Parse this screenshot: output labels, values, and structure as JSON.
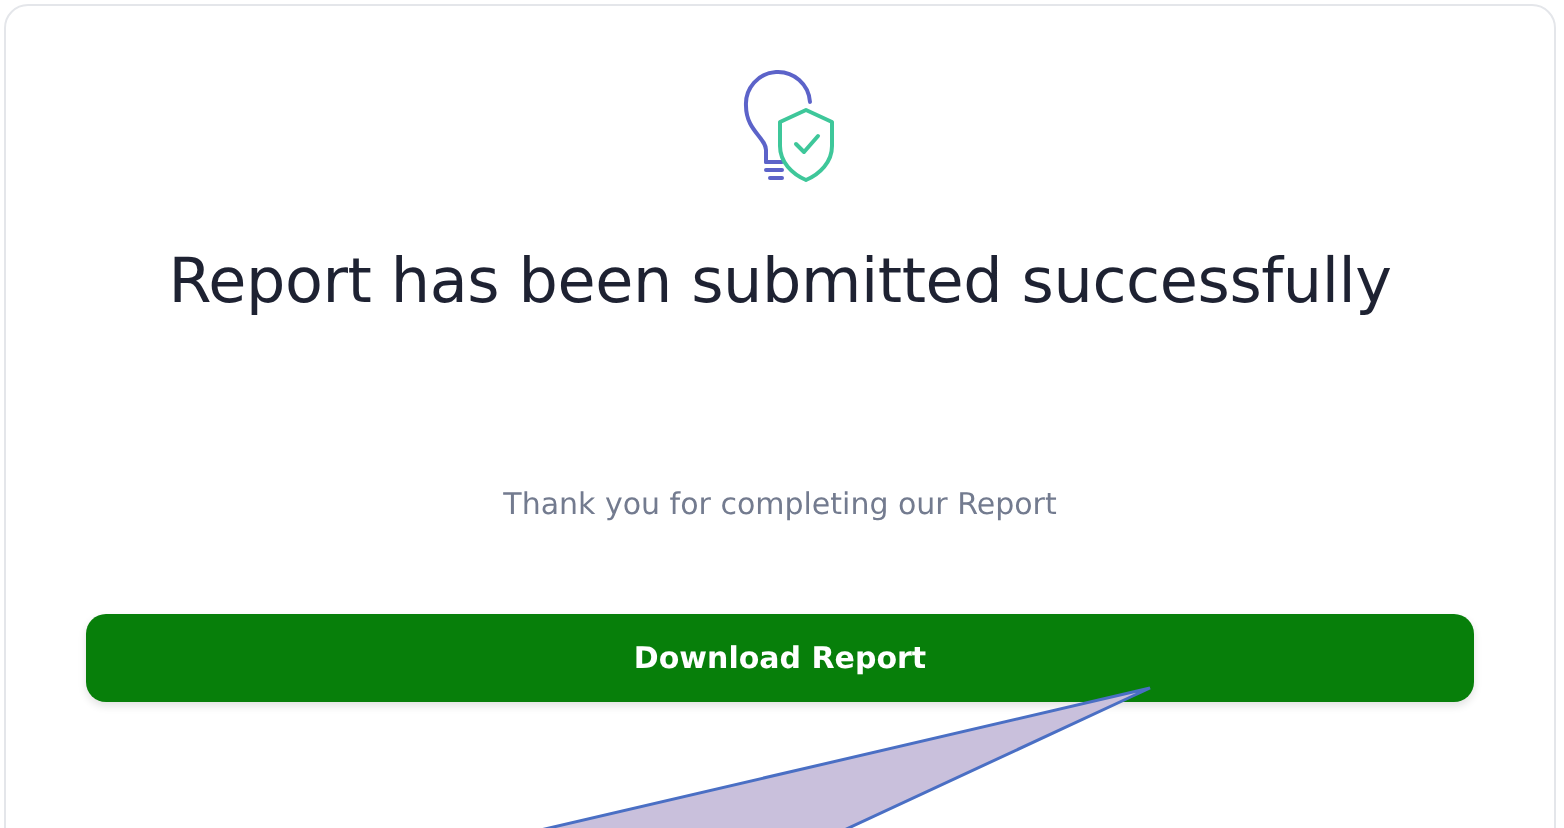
{
  "title": "Report has been submitted successfully",
  "message": "Thank you for completing our Report",
  "button": {
    "label": "Download Report"
  }
}
